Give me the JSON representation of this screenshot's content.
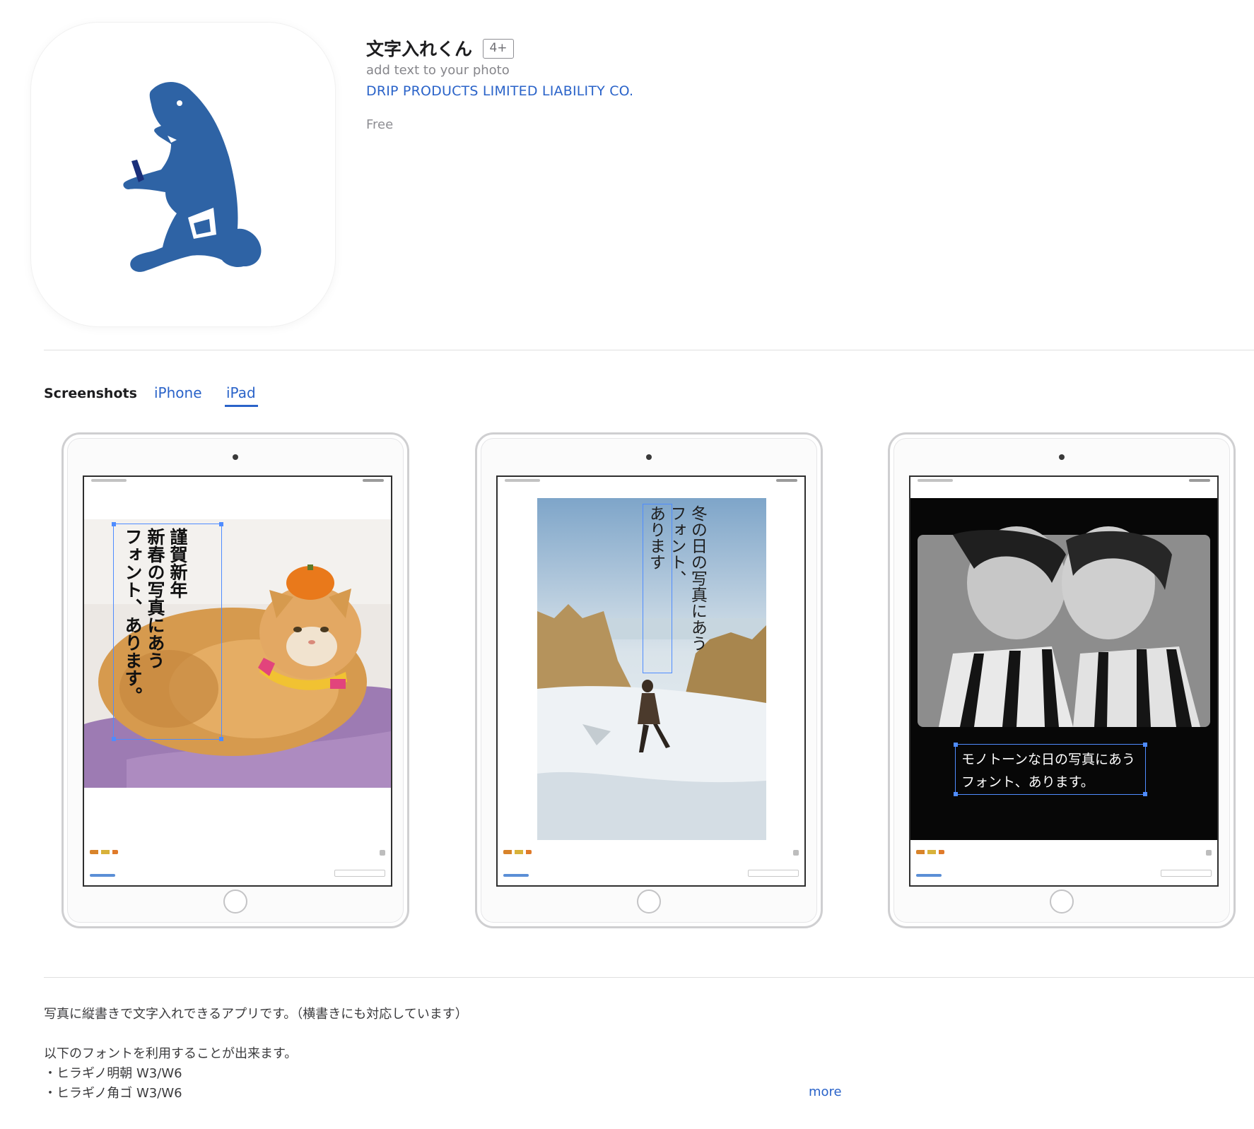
{
  "app": {
    "title": "文字入れくん",
    "age_rating": "4+",
    "subtitle": "add text to your photo",
    "developer": "DRIP PRODUCTS LIMITED LIABILITY CO.",
    "price": "Free",
    "icon": "bear-logo-icon",
    "brand_color": "#2e63a5"
  },
  "screenshots": {
    "title": "Screenshots",
    "tabs": [
      {
        "label": "iPhone",
        "selected": false
      },
      {
        "label": "iPad",
        "selected": true
      }
    ],
    "items": [
      {
        "vertical_lines": [
          "謹賀新年",
          "新春の写真にあう",
          "フォント、あります。"
        ],
        "photo": "orange cat wearing a tangerine on its head"
      },
      {
        "vertical_lines": [
          "冬の日の写真にあう",
          "フォント、",
          "あります"
        ],
        "photo": "person walking on snowy shore"
      },
      {
        "horizontal_lines": [
          "モノトーンな日の写真にあう",
          "フォント、あります。"
        ],
        "photo": "black and white portrait of two people"
      }
    ]
  },
  "description": {
    "lines": [
      "写真に縦書きで文字入れできるアプリです。（横書きにも対応しています）",
      "",
      "以下のフォントを利用することが出来ます。",
      "・ヒラギノ明朝 W3/W6",
      "・ヒラギノ角ゴ W3/W6"
    ],
    "more_label": "more"
  },
  "colors": {
    "link": "#2a63c9"
  }
}
